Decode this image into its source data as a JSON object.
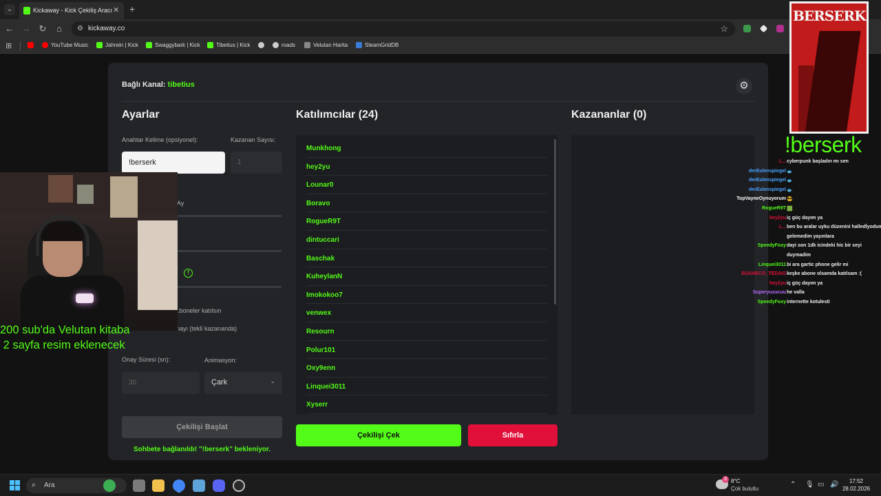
{
  "browser": {
    "tab_title": "Kickaway - Kick Çekiliş Aracı",
    "url": "kickaway.co",
    "bookmarks": [
      {
        "label": "YouTube Music",
        "color": "#ff0000"
      },
      {
        "label": "Jahrein | Kick",
        "color": "#53fc18"
      },
      {
        "label": "Swaggybark | Kick",
        "color": "#53fc18"
      },
      {
        "label": "Tibetius | Kick",
        "color": "#53fc18"
      },
      {
        "label": "",
        "color": "#cccccc"
      },
      {
        "label": "roads",
        "color": "#cccccc"
      },
      {
        "label": "Velutan Harita",
        "color": "#888888"
      },
      {
        "label": "SteamGridDB",
        "color": "#3a7bd5"
      }
    ]
  },
  "app": {
    "channel_label": "Bağlı Kanal:",
    "channel_name": "tibetius",
    "settings": {
      "title": "Ayarlar",
      "keyword_label": "Anahtar Kelime (opsiyonel):",
      "keyword_value": "!berserk",
      "winner_count_label": "Kazanan Sayısı:",
      "winner_count_value": "1",
      "partial_label_1": "Ay",
      "partial_option_1": "...boneler katılsın",
      "partial_option_2": "Kazanan onayı (tekli kazananda)",
      "confirm_time_label": "Onay Süresi (sn):",
      "confirm_time_value": "30",
      "animation_label": "Animasyon:",
      "animation_value": "Çark",
      "start_button": "Çekilişi Başlat",
      "status": "Sohbete bağlanıldı! \"!berserk\" bekleniyor."
    },
    "participants": {
      "title": "Katılımcılar (24)",
      "names": [
        "Munkhong",
        "hey2yu",
        "Lounar0",
        "Boravo",
        "RogueR9T",
        "dintuccari",
        "Baschak",
        "KuheylanN",
        "Imokokoo7",
        "venwex",
        "Resourn",
        "Polur101",
        "Oxy9enn",
        "Linquei3011",
        "Xyserr"
      ]
    },
    "winners": {
      "title": "Kazananlar (0)"
    },
    "draw_button": "Çekilişi Çek",
    "reset_button": "Sıfırla"
  },
  "stream_overlay": {
    "note": "200 sub'da Velutan kitaba\n 2 sayfa resim eklenecek",
    "poster_title": "BERSERK",
    "keyword": "!berserk",
    "chat": [
      {
        "user": "L...",
        "msg": "cyberpunk başladın mı sen",
        "color": "#e0103b"
      },
      {
        "user": "derEulenspiegel",
        "msg": "🐟",
        "color": "#4aa3ff"
      },
      {
        "user": "derEulenspiegel",
        "msg": "🐟",
        "color": "#4aa3ff"
      },
      {
        "user": "derEulenspiegel",
        "msg": "🐟",
        "color": "#4aa3ff"
      },
      {
        "user": "TopVayneOynuyorum",
        "msg": "😎",
        "color": "#ffffff"
      },
      {
        "user": "RogueR9T",
        "msg": "🟩",
        "color": "#53fc18"
      },
      {
        "user": "hey2yu",
        "msg": "iç güç dayım ya",
        "color": "#e0103b"
      },
      {
        "user": "L...",
        "msg": "ben bu aralar uyku düzenini halledİyodum",
        "color": "#e0103b"
      },
      {
        "user": "",
        "msg": "gelemedim yayınlara",
        "color": "#e0103b"
      },
      {
        "user": "SpeedyFoxy",
        "msg": "dayi son 1dk icindeki hic bir seyi",
        "color": "#53fc18"
      },
      {
        "user": "",
        "msg": "duymadim",
        "color": "#53fc18"
      },
      {
        "user": "Linquei3011",
        "msg": "bi ara gartic phone gelir mi",
        "color": "#53fc18"
      },
      {
        "user": "BUSHECO_TEDAIS",
        "msg": "keşke abone olsamda katılsam :(",
        "color": "#e0103b"
      },
      {
        "user": "hey2yu",
        "msg": "iç güç dayım ya",
        "color": "#e0103b"
      },
      {
        "user": "Superyuzucuu",
        "msg": "he valla",
        "color": "#b56cff"
      },
      {
        "user": "SpeedyFoxy",
        "msg": "internette kotulesti",
        "color": "#53fc18"
      }
    ]
  },
  "taskbar": {
    "search_label": "Ara",
    "weather_badge": "3",
    "weather_temp": "8°C",
    "weather_desc": "Çok bulutlu",
    "time": "17:52",
    "date": "28.02.2026"
  }
}
